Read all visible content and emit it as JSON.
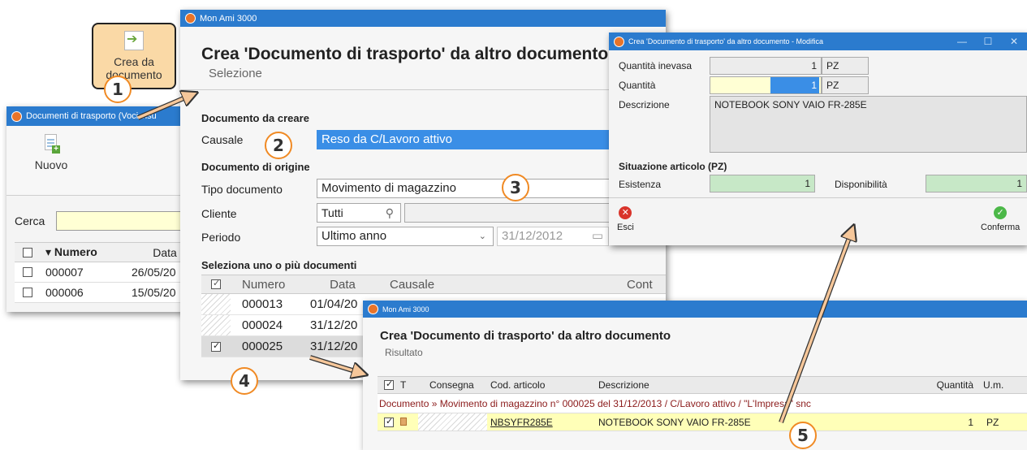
{
  "win1": {
    "title": "Documenti di trasporto (Voci visu",
    "toolbar": {
      "new_label": "Nuovo",
      "create_from_doc_label": "Crea da documento"
    },
    "search_label": "Cerca",
    "grid": {
      "col_number": "▾ Numero",
      "col_date": "Data",
      "rows": [
        {
          "number": "000007",
          "date": "26/05/20"
        },
        {
          "number": "000006",
          "date": "15/05/20"
        }
      ]
    }
  },
  "win2": {
    "title": "Mon Ami 3000",
    "heading": "Crea 'Documento di trasporto' da altro documento",
    "subheading": "Selezione",
    "section_create": "Documento da creare",
    "causale_label": "Causale",
    "causale_value": "Reso da C/Lavoro attivo",
    "section_origin": "Documento di origine",
    "doc_type_label": "Tipo documento",
    "doc_type_value": "Movimento di magazzino",
    "client_label": "Cliente",
    "client_value": "Tutti",
    "period_label": "Periodo",
    "period_value": "Ultimo anno",
    "period_date": "31/12/2012",
    "section_select": "Seleziona uno o più documenti",
    "grid": {
      "col_number": "Numero",
      "col_date": "Data",
      "col_causale": "Causale",
      "col_contact": "Cont",
      "rows": [
        {
          "number": "000013",
          "date": "01/04/20",
          "checked": false
        },
        {
          "number": "000024",
          "date": "31/12/20",
          "checked": false
        },
        {
          "number": "000025",
          "date": "31/12/20",
          "checked": true
        }
      ]
    }
  },
  "win3": {
    "title": "Crea 'Documento di trasporto' da altro documento - Modifica",
    "qty_open_label": "Quantità inevasa",
    "qty_open_value": "1",
    "qty_open_unit": "PZ",
    "qty_label": "Quantità",
    "qty_value": "1",
    "qty_unit": "PZ",
    "desc_label": "Descrizione",
    "desc_value": "NOTEBOOK SONY VAIO FR-285E",
    "situation_label": "Situazione articolo (PZ)",
    "stock_label": "Esistenza",
    "stock_value": "1",
    "avail_label": "Disponibilità",
    "avail_value": "1",
    "exit_label": "Esci",
    "confirm_label": "Conferma",
    "colors": {
      "exit": "#d9342b",
      "confirm": "#4cb848"
    }
  },
  "win4": {
    "title": "Mon Ami 3000",
    "heading": "Crea 'Documento di trasporto' da altro documento",
    "subheading": "Risultato",
    "grid": {
      "col_t": "T",
      "col_delivery": "Consegna",
      "col_code": "Cod. articolo",
      "col_desc": "Descrizione",
      "col_qty": "Quantità",
      "col_um": "U.m.",
      "group_row": "Documento » Movimento di magazzino n° 000025 del 31/12/2013 / C/Lavoro attivo / \"L'Impresa\" snc",
      "row": {
        "code": "NBSYFR285E",
        "desc": "NOTEBOOK SONY VAIO FR-285E",
        "qty": "1",
        "um": "PZ"
      }
    }
  },
  "callouts": [
    "1",
    "2",
    "3",
    "4",
    "5"
  ],
  "colors": {
    "titlebar": "#2b7bce",
    "callout_border": "#f08a24",
    "selection": "#3a8ee6",
    "highlight_button": "#fad9a6"
  }
}
